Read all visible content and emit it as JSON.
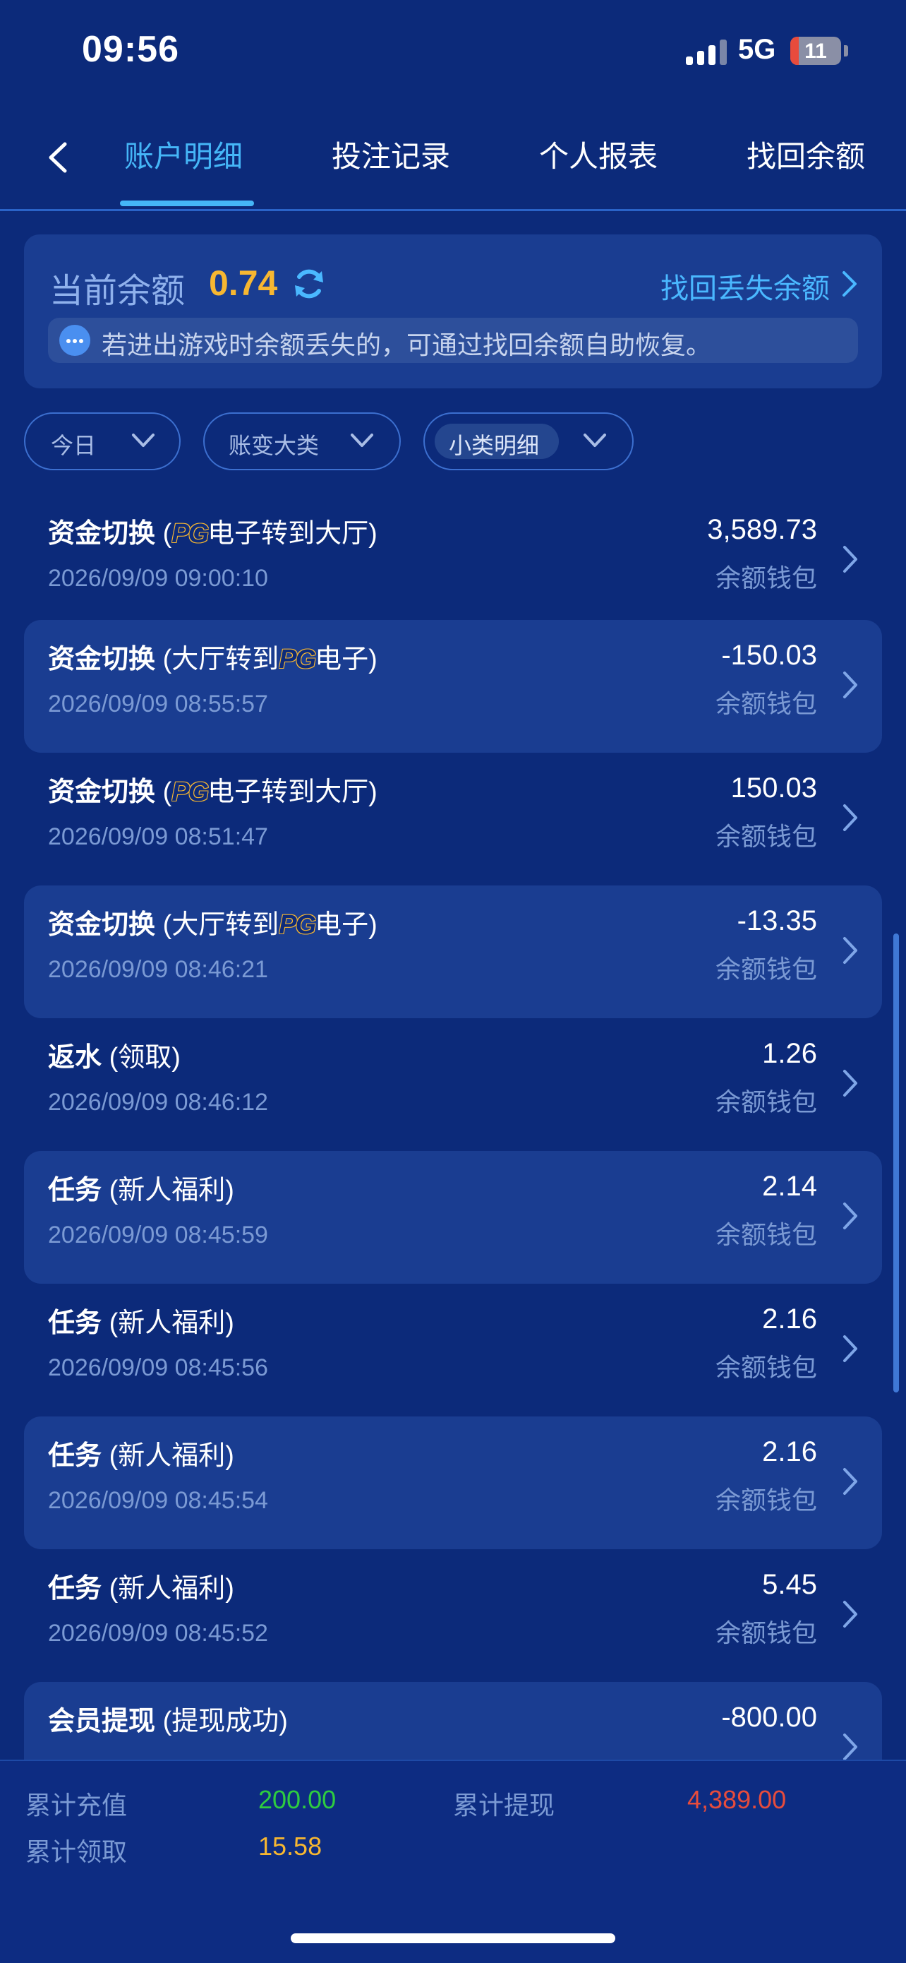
{
  "status_bar": {
    "time": "09:56",
    "network": "5G",
    "battery": "11"
  },
  "tabs": [
    {
      "label": "账户明细",
      "active": true
    },
    {
      "label": "投注记录",
      "active": false
    },
    {
      "label": "个人报表",
      "active": false
    },
    {
      "label": "找回余额",
      "active": false
    }
  ],
  "balance": {
    "label": "当前余额",
    "value": "0.74",
    "recover_link": "找回丢失余额",
    "hint": "若进出游戏时余额丢失的，可通过找回余额自助恢复。"
  },
  "filters": [
    {
      "label": "今日"
    },
    {
      "label": "账变大类"
    },
    {
      "label": "小类明细"
    }
  ],
  "records": [
    {
      "category": "资金切换",
      "detail_before": "(",
      "pg": "PG",
      "detail_after": "电子转到大厅)",
      "time": "2026/09/09 09:00:10",
      "amount": "3,589.73",
      "wallet": "余额钱包"
    },
    {
      "category": "资金切换",
      "detail_before": "(大厅转到",
      "pg": "PG",
      "detail_after": "电子)",
      "time": "2026/09/09 08:55:57",
      "amount": "-150.03",
      "wallet": "余额钱包"
    },
    {
      "category": "资金切换",
      "detail_before": "(",
      "pg": "PG",
      "detail_after": "电子转到大厅)",
      "time": "2026/09/09 08:51:47",
      "amount": "150.03",
      "wallet": "余额钱包"
    },
    {
      "category": "资金切换",
      "detail_before": "(大厅转到",
      "pg": "PG",
      "detail_after": "电子)",
      "time": "2026/09/09 08:46:21",
      "amount": "-13.35",
      "wallet": "余额钱包"
    },
    {
      "category": "返水",
      "detail_before": "(领取)",
      "pg": "",
      "detail_after": "",
      "time": "2026/09/09 08:46:12",
      "amount": "1.26",
      "wallet": "余额钱包"
    },
    {
      "category": "任务",
      "detail_before": "(新人福利)",
      "pg": "",
      "detail_after": "",
      "time": "2026/09/09 08:45:59",
      "amount": "2.14",
      "wallet": "余额钱包"
    },
    {
      "category": "任务",
      "detail_before": "(新人福利)",
      "pg": "",
      "detail_after": "",
      "time": "2026/09/09 08:45:56",
      "amount": "2.16",
      "wallet": "余额钱包"
    },
    {
      "category": "任务",
      "detail_before": "(新人福利)",
      "pg": "",
      "detail_after": "",
      "time": "2026/09/09 08:45:54",
      "amount": "2.16",
      "wallet": "余额钱包"
    },
    {
      "category": "任务",
      "detail_before": "(新人福利)",
      "pg": "",
      "detail_after": "",
      "time": "2026/09/09 08:45:52",
      "amount": "5.45",
      "wallet": "余额钱包"
    },
    {
      "category": "会员提现",
      "detail_before": "(提现成功)",
      "pg": "",
      "detail_after": "",
      "time": "",
      "amount": "-800.00",
      "wallet": ""
    }
  ],
  "summary": {
    "recharge_label": "累计充值",
    "recharge_value": "200.00",
    "withdraw_label": "累计提现",
    "withdraw_value": "4,389.00",
    "claim_label": "累计领取",
    "claim_value": "15.58"
  },
  "colors": {
    "background": "#0c2a7a",
    "card": "#1a3d91",
    "accent": "#45b6f7",
    "balance_gold": "#f7b731",
    "recharge_green": "#2ecc40",
    "withdraw_red": "#e74c3c",
    "claim_gold": "#f7b731"
  }
}
